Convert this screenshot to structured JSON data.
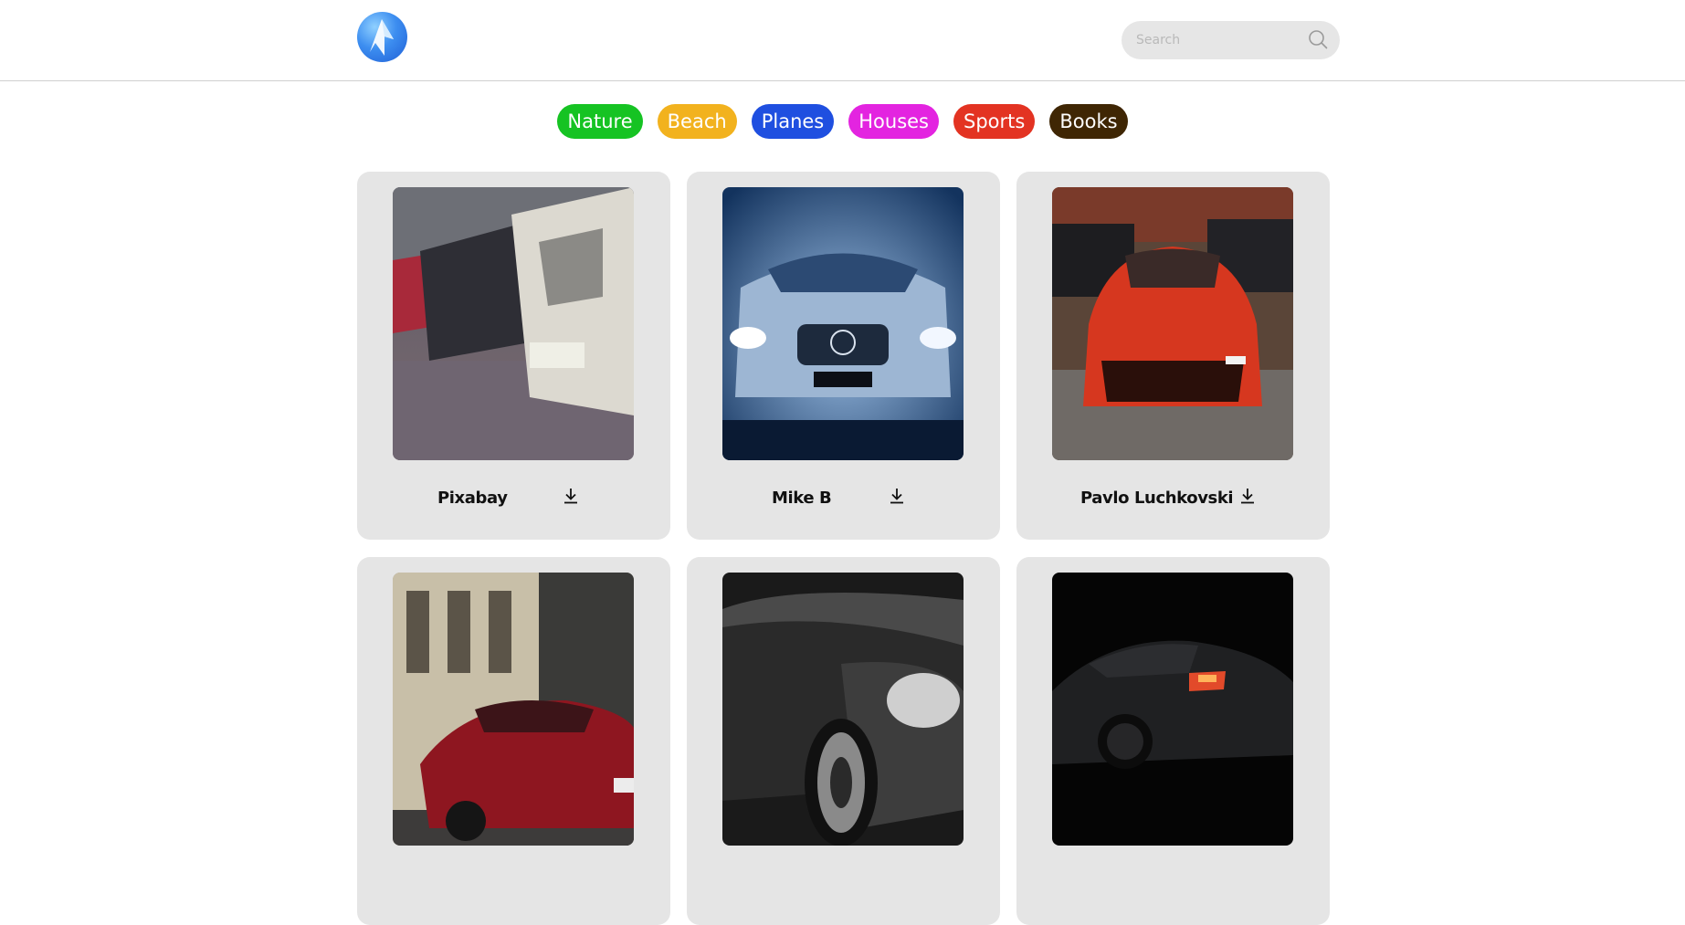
{
  "header": {
    "logo": "logo-icon",
    "search": {
      "placeholder": "Search",
      "value": "",
      "icon": "search-icon"
    }
  },
  "categories": [
    {
      "label": "Nature",
      "color": "#16c323"
    },
    {
      "label": "Beach",
      "color": "#f2b21e"
    },
    {
      "label": "Planes",
      "color": "#1f4fe0"
    },
    {
      "label": "Houses",
      "color": "#e324e0"
    },
    {
      "label": "Sports",
      "color": "#e33322"
    },
    {
      "label": "Books",
      "color": "#3f2604"
    }
  ],
  "photos": [
    {
      "author": "Pixabay",
      "icon": "download-icon"
    },
    {
      "author": "Mike B",
      "icon": "download-icon"
    },
    {
      "author": "Pavlo Luchkovski",
      "icon": "download-icon"
    },
    {
      "author": "",
      "icon": "download-icon"
    },
    {
      "author": "",
      "icon": "download-icon"
    },
    {
      "author": "",
      "icon": "download-icon"
    }
  ]
}
